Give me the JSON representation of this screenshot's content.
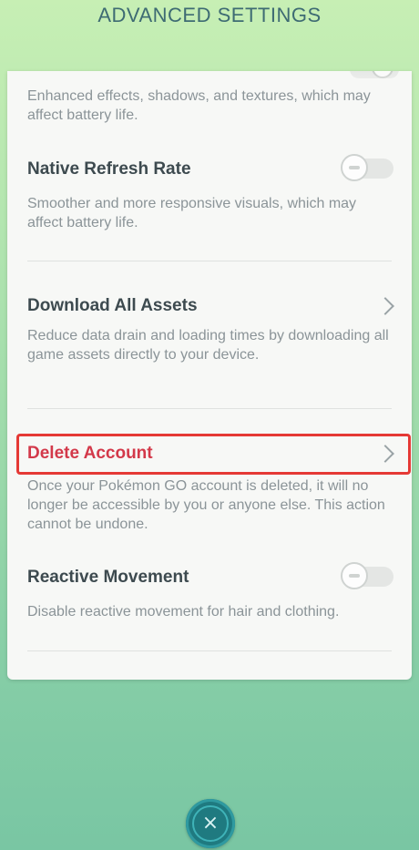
{
  "header": {
    "title": "ADVANCED SETTINGS"
  },
  "settings": {
    "effects": {
      "description": "Enhanced effects, shadows, and textures, which may affect battery life.",
      "toggle_on": false
    },
    "native_refresh": {
      "title": "Native Refresh Rate",
      "description": "Smoother and more responsive visuals, which may affect battery life.",
      "toggle_on": false
    },
    "download_assets": {
      "title": "Download All Assets",
      "description": "Reduce data drain and loading times by downloading all game assets directly to your device."
    },
    "delete_account": {
      "title": "Delete Account",
      "description": "Once your Pokémon GO account is deleted, it will no longer be accessible by you or anyone else. This action cannot be undone."
    },
    "reactive_movement": {
      "title": "Reactive Movement",
      "description": "Disable reactive movement for hair and clothing.",
      "toggle_on": false
    }
  },
  "footer": {
    "close_icon": "×"
  },
  "colors": {
    "danger": "#d3394a",
    "highlight": "#e53935",
    "title": "#3e6b73"
  }
}
